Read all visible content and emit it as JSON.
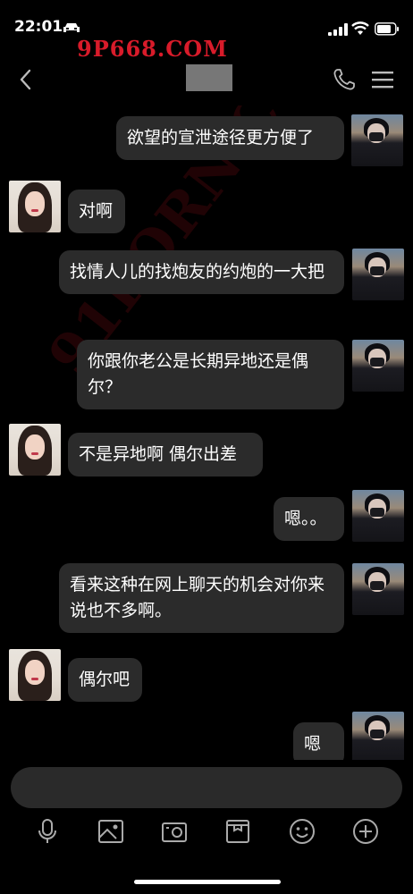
{
  "status_bar": {
    "time": "22:01",
    "watermark": "9P668.COM",
    "icons": [
      "car-icon",
      "signal-icon",
      "wifi-icon",
      "battery-icon"
    ]
  },
  "nav": {
    "back_icon": "chevron-left-icon",
    "contact_name": "",
    "phone_icon": "phone-icon",
    "menu_icon": "menu-icon"
  },
  "watermark_diagonal": "91PORN.COM",
  "messages": [
    {
      "sender": "me",
      "text": "欲望的宣泄途径更方便了"
    },
    {
      "sender": "her",
      "text": "对啊"
    },
    {
      "sender": "me",
      "text": "找情人儿的找炮友的约炮的一大把"
    },
    {
      "sender": "me",
      "text": "你跟你老公是长期异地还是偶尔？"
    },
    {
      "sender": "her",
      "text": "不是异地啊 偶尔出差"
    },
    {
      "sender": "me",
      "text": "嗯。。"
    },
    {
      "sender": "me",
      "text": "看来这种在网上聊天的机会对你来说也不多啊。"
    },
    {
      "sender": "her",
      "text": "偶尔吧"
    },
    {
      "sender": "me",
      "text": "嗯"
    }
  ],
  "input": {
    "value": "",
    "placeholder": ""
  },
  "toolbar": [
    "microphone-icon",
    "image-icon",
    "camera-icon",
    "gift-icon",
    "emoji-icon",
    "plus-icon"
  ],
  "colors": {
    "background": "#000000",
    "bubble": "#2b2b2b",
    "text": "#ffffff",
    "watermark": "#d81b2a",
    "input": "#2a2a2a"
  }
}
